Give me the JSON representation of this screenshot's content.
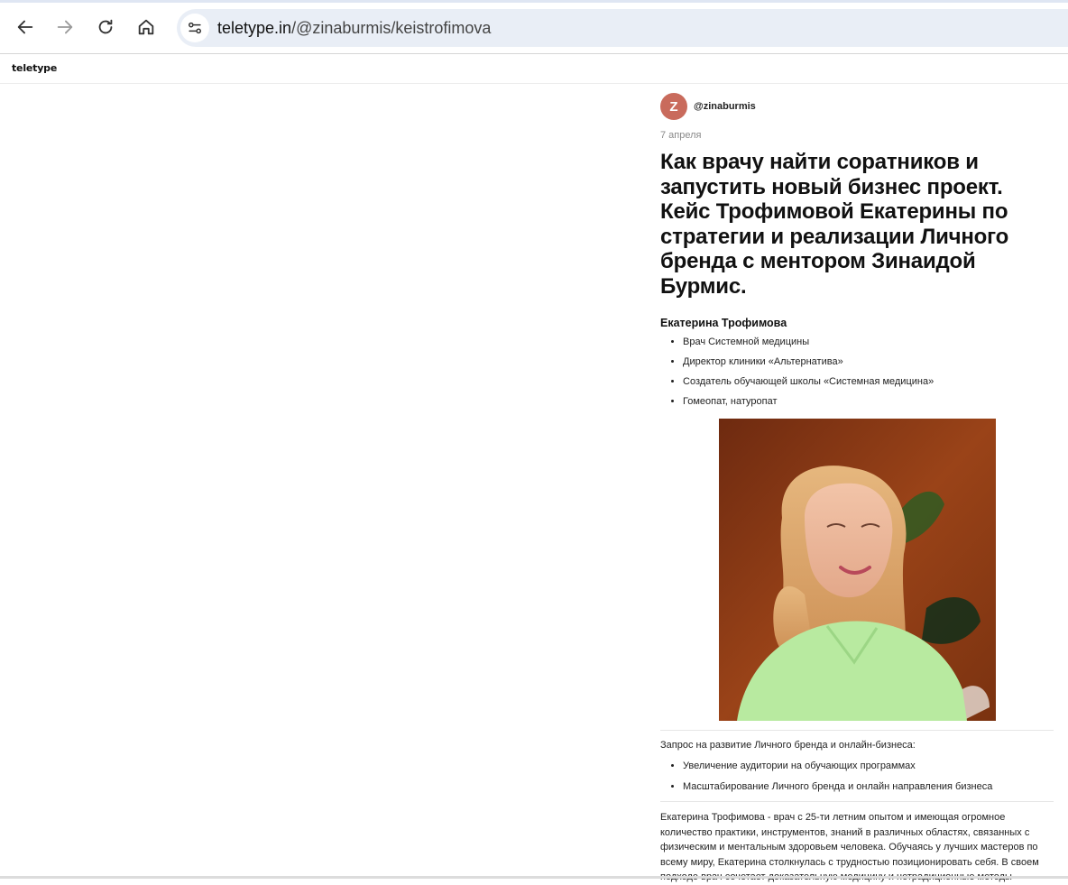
{
  "browser": {
    "url_domain": "teletype.in",
    "url_path": "/@zinaburmis/keistrofimova"
  },
  "site": {
    "logo": "teletype"
  },
  "article": {
    "author_initial": "Z",
    "author_handle": "@zinaburmis",
    "date": "7 апреля",
    "title": "Как врачу найти соратников и запустить новый бизнес проект. Кейс Трофимовой Екатерины по стратегии и реализации Личного бренда с ментором Зинаидой Бурмис.",
    "subtitle": "Екатерина Трофимова",
    "roles": [
      "Врач Системной медицины",
      "Директор клиники «Альтернатива»",
      "Создатель обучающей школы «Системная медицина»",
      "Гомеопат, натуропат"
    ],
    "request_intro": "Запрос на развитие Личного бренда и онлайн-бизнеса:",
    "requests": [
      "Увеличение аудитории на обучающих программах",
      "Масштабирование Личного бренда и онлайн направления бизнеса"
    ],
    "body": "Екатерина Трофимова - врач с 25-ти летним опытом и имеющая огромное количество практики, инструментов, знаний в различных областях, связанных с физическим и ментальным здоровьем человека. Обучаясь у лучших мастеров по всему миру, Екатерина столкнулась с трудностью позиционировать себя. В своем подходе врач сочетает доказательную медицину и нетрадиционные методы"
  },
  "colors": {
    "avatar": "#c96b5c",
    "omnibox": "#e9eef6",
    "photo_background": "#8a3a16",
    "blouse": "#b8eaa0"
  },
  "icons": {
    "back": "arrow-left-icon",
    "forward": "arrow-right-icon",
    "reload": "reload-icon",
    "home": "home-icon",
    "site_info": "tune-icon"
  }
}
